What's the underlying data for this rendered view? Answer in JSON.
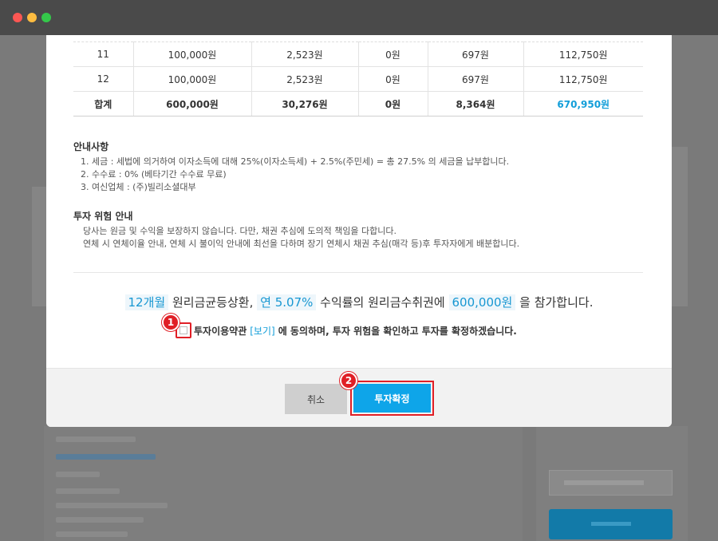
{
  "window": {
    "controls": [
      "close",
      "minimize",
      "maximize"
    ]
  },
  "schedule": {
    "rows": [
      {
        "period": "11",
        "principal": "100,000원",
        "interest": "2,523원",
        "fee": "0원",
        "tax": "697원",
        "payout": "112,750원"
      },
      {
        "period": "12",
        "principal": "100,000원",
        "interest": "2,523원",
        "fee": "0원",
        "tax": "697원",
        "payout": "112,750원"
      }
    ],
    "total": {
      "label": "합계",
      "principal": "600,000원",
      "interest": "30,276원",
      "fee": "0원",
      "tax": "8,364원",
      "payout": "670,950원"
    }
  },
  "notice": {
    "title": "안내사항",
    "items": [
      "1. 세금 : 세법에 의거하여 이자소득에 대해 25%(이자소득세) + 2.5%(주민세) = 총 27.5% 의 세금을 납부합니다.",
      "2. 수수료 : 0% (베타기간 수수료 무료)",
      "3. 여신업체 : (주)빌리소셜대부"
    ]
  },
  "risk": {
    "title": "투자 위험 안내",
    "lines": [
      "당사는 원금 및 수익을 보장하지 않습니다. 다만, 채권 추심에 도의적 책임을 다합니다.",
      "연체 시 연체이율 안내, 연체 시 불이익 안내에 최선을 다하며 장기 연체시 채권 추심(매각 등)후 투자자에게 배분합니다."
    ]
  },
  "summary": {
    "term": "12개월",
    "repay_method": "원리금균등상환,",
    "rate": "연 5.07%",
    "rate_suffix": "수익률의 원리금수취권에",
    "amount": "600,000원",
    "amount_suffix": "을 참가합니다."
  },
  "agreement": {
    "checked": false,
    "terms_label": "투자이용약관",
    "view_link": "[보기]",
    "text": "에 동의하며, 투자 위험을 확인하고 투자를 확정하겠습니다."
  },
  "annotations": {
    "step1": "1",
    "step2": "2",
    "color": "#e01f26"
  },
  "buttons": {
    "cancel": "취소",
    "confirm": "투자확정"
  },
  "colors": {
    "accent": "#129ed9",
    "confirm_button": "#0ea5e9"
  }
}
